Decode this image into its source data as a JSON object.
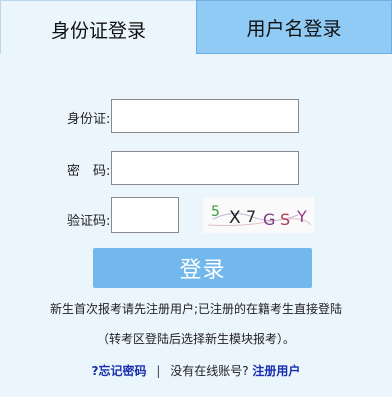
{
  "tabs": {
    "id_login": "身份证登录",
    "username_login": "用户名登录"
  },
  "form": {
    "id_label": "身份证:",
    "password_label": "密　码:",
    "captcha_label": "验证码:",
    "id_value": "",
    "password_value": "",
    "captcha_value": ""
  },
  "captcha_text": "5X7GSY",
  "login_button": "登录",
  "notes": {
    "line1": "新生首次报考请先注册用户;已注册的在籍考生直接登陆",
    "line2": "（转考区登陆后选择新生模块报考）。"
  },
  "links": {
    "forgot_password": "?忘记密码",
    "separator": "|",
    "no_account": "没有在线账号?",
    "register": "注册用户"
  },
  "colors": {
    "background": "#eaf5fc",
    "inactive_tab": "#8fcbf5",
    "button": "#73b8ed",
    "link": "#1a2fb0"
  }
}
